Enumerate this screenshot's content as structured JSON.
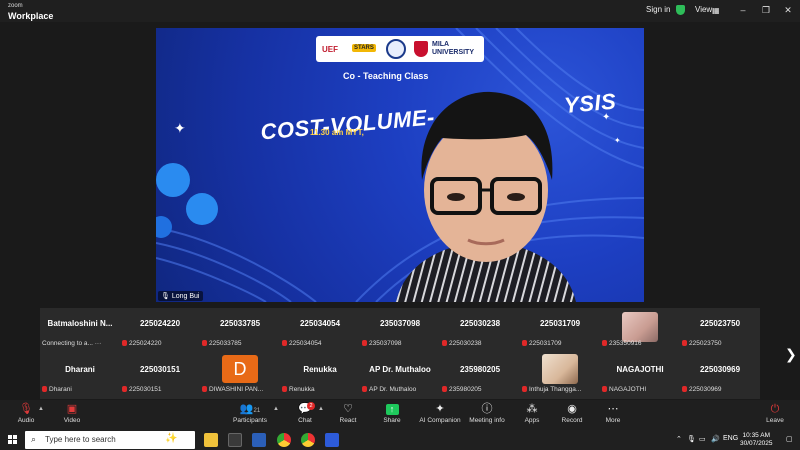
{
  "titlebar": {
    "app_line1": "zoom",
    "app_line2": "Workplace",
    "signin": "Sign in",
    "view": "View",
    "minimize": "–",
    "maximize": "❐",
    "close": "✕"
  },
  "video": {
    "class_title": "Co - Teaching Class",
    "big_title": "COST-VOLUME-",
    "big_title_tail": "YSIS",
    "time_text": "11.30 am MYT,",
    "logos": {
      "uef": "UEF",
      "stars": "STARS",
      "mila_line1": "MILA",
      "mila_line2": "UNIVERSITY"
    },
    "speaker_name": "Long Bui"
  },
  "gallery": {
    "row1": [
      {
        "name": "Batmaloshini N...",
        "sub": "Connecting to a...",
        "muted": false,
        "avatar": "none"
      },
      {
        "name": "225024220",
        "sub": "225024220",
        "muted": true,
        "avatar": "none"
      },
      {
        "name": "225033785",
        "sub": "225033785",
        "muted": true,
        "avatar": "none"
      },
      {
        "name": "225034054",
        "sub": "225034054",
        "muted": true,
        "avatar": "none"
      },
      {
        "name": "235037098",
        "sub": "235037098",
        "muted": true,
        "avatar": "none"
      },
      {
        "name": "225030238",
        "sub": "225030238",
        "muted": true,
        "avatar": "none"
      },
      {
        "name": "225031709",
        "sub": "225031709",
        "muted": true,
        "avatar": "none"
      },
      {
        "name": "",
        "sub": "235350916",
        "muted": true,
        "avatar": "photo"
      },
      {
        "name": "225023750",
        "sub": "225023750",
        "muted": true,
        "avatar": "none"
      }
    ],
    "row2": [
      {
        "name": "Dharani",
        "sub": "Dharani",
        "muted": true,
        "avatar": "none"
      },
      {
        "name": "225030151",
        "sub": "225030151",
        "muted": true,
        "avatar": "none"
      },
      {
        "name": "",
        "sub": "DIWASHINI PAN...",
        "muted": true,
        "avatar": "letter",
        "letter": "D"
      },
      {
        "name": "Renukka",
        "sub": "Renukka",
        "muted": true,
        "avatar": "none"
      },
      {
        "name": "AP Dr. Muthaloo",
        "sub": "AP Dr. Muthaloo",
        "muted": true,
        "avatar": "none"
      },
      {
        "name": "235980205",
        "sub": "235980205",
        "muted": true,
        "avatar": "none"
      },
      {
        "name": "",
        "sub": "Inthuja Thangga...",
        "muted": true,
        "avatar": "photo"
      },
      {
        "name": "NAGAJOTHI",
        "sub": "NAGAJOTHI",
        "muted": true,
        "avatar": "none"
      },
      {
        "name": "225030969",
        "sub": "225030969",
        "muted": true,
        "avatar": "none"
      }
    ],
    "next": "❯"
  },
  "controls": {
    "audio": "Audio",
    "video": "Video",
    "participants": "Participants",
    "participants_count": "21",
    "chat": "Chat",
    "chat_badge": "2",
    "react": "React",
    "share": "Share",
    "ai": "AI Companion",
    "meeting_info": "Meeting info",
    "apps": "Apps",
    "record": "Record",
    "more": "More",
    "leave": "Leave"
  },
  "taskbar": {
    "search_placeholder": "Type here to search",
    "lang": "ENG",
    "time": "10:35 AM",
    "date": "30/07/2025"
  }
}
